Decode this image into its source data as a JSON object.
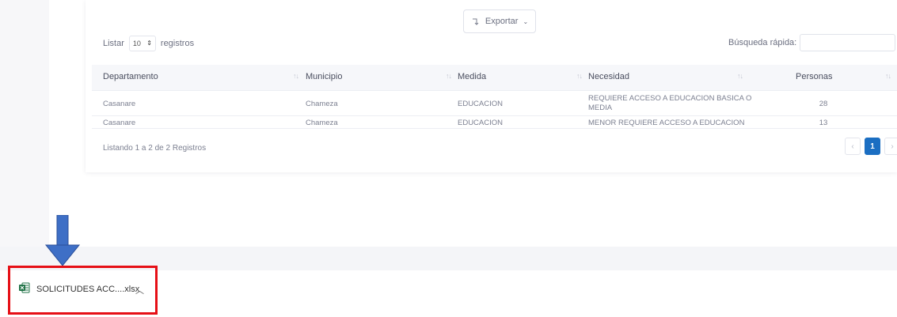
{
  "toolbar": {
    "export_label": "Exportar"
  },
  "length": {
    "prefix": "Listar",
    "value": "10",
    "suffix": "registros"
  },
  "search": {
    "label": "Búsqueda rápida:",
    "value": ""
  },
  "table": {
    "headers": [
      "Departamento",
      "Municipio",
      "Medida",
      "Necesidad",
      "Personas"
    ],
    "rows": [
      [
        "Casanare",
        "Chameza",
        "EDUCACION",
        "REQUIERE ACCESO A EDUCACION BASICA O MEDIA",
        "28"
      ],
      [
        "Casanare",
        "Chameza",
        "EDUCACION",
        "MENOR REQUIERE ACCESO A EDUCACION",
        "13"
      ]
    ]
  },
  "info": "Listando 1 a 2 de 2 Registros",
  "pagination": {
    "prev": "‹",
    "current": "1",
    "next": "›"
  },
  "download": {
    "filename": "SOLICITUDES ACC....xlsx",
    "icon": "excel-file-icon"
  },
  "colors": {
    "accent": "#1b6ec2",
    "highlight_box": "#e60f16",
    "arrow": "#3e6fc6"
  }
}
